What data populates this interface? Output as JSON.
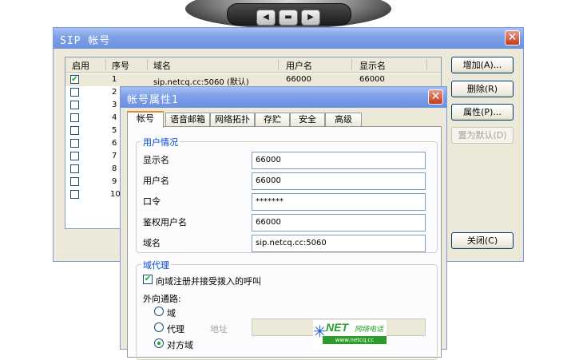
{
  "phone": {
    "btn_left": "◀",
    "btn_mid": "▬",
    "btn_right": "▶"
  },
  "sip_window": {
    "title": "SIP 帐号",
    "columns": [
      "启用",
      "序号",
      "域名",
      "用户名",
      "显示名"
    ],
    "rows": [
      {
        "checked": true,
        "num": "1",
        "domain": "sip.netcq.cc:5060 (默认)",
        "user": "66000",
        "display": "66000"
      },
      {
        "checked": false,
        "num": "2",
        "domain": "",
        "user": "",
        "display": ""
      },
      {
        "checked": false,
        "num": "3",
        "domain": "",
        "user": "",
        "display": ""
      },
      {
        "checked": false,
        "num": "4",
        "domain": "",
        "user": "",
        "display": ""
      },
      {
        "checked": false,
        "num": "5",
        "domain": "",
        "user": "",
        "display": ""
      },
      {
        "checked": false,
        "num": "6",
        "domain": "",
        "user": "",
        "display": ""
      },
      {
        "checked": false,
        "num": "7",
        "domain": "",
        "user": "",
        "display": ""
      },
      {
        "checked": false,
        "num": "8",
        "domain": "",
        "user": "",
        "display": ""
      },
      {
        "checked": false,
        "num": "9",
        "domain": "",
        "user": "",
        "display": ""
      },
      {
        "checked": false,
        "num": "10",
        "domain": "",
        "user": "",
        "display": ""
      }
    ],
    "buttons": {
      "add": "增加(A)...",
      "delete": "删除(R)",
      "properties": "属性(P)...",
      "set_default": "置为默认(D)",
      "close": "关闭(C)"
    }
  },
  "prop_window": {
    "title": "帐号属性1",
    "tabs": [
      "帐号",
      "语音邮箱",
      "网络拓扑",
      "存贮",
      "安全",
      "高级"
    ],
    "user_info": {
      "title": "用户情况",
      "display_name_label": "显示名",
      "display_name": "66000",
      "user_name_label": "用户名",
      "user_name": "66000",
      "password_label": "口令",
      "password": "*******",
      "auth_user_label": "鉴权用户名",
      "auth_user": "66000",
      "domain_label": "域名",
      "domain": "sip.netcq.cc:5060"
    },
    "proxy": {
      "title": "域代理",
      "register_label": "向域注册并接受拨入的呼叫",
      "outbound_label": "外向通路:",
      "opt_domain": "域",
      "opt_proxy": "代理",
      "address_label": "地址",
      "address_value": "",
      "opt_target": "对方域"
    },
    "logo": {
      "net": "NET",
      "cn": "网络电话",
      "url": "www.netcq.cc"
    }
  }
}
